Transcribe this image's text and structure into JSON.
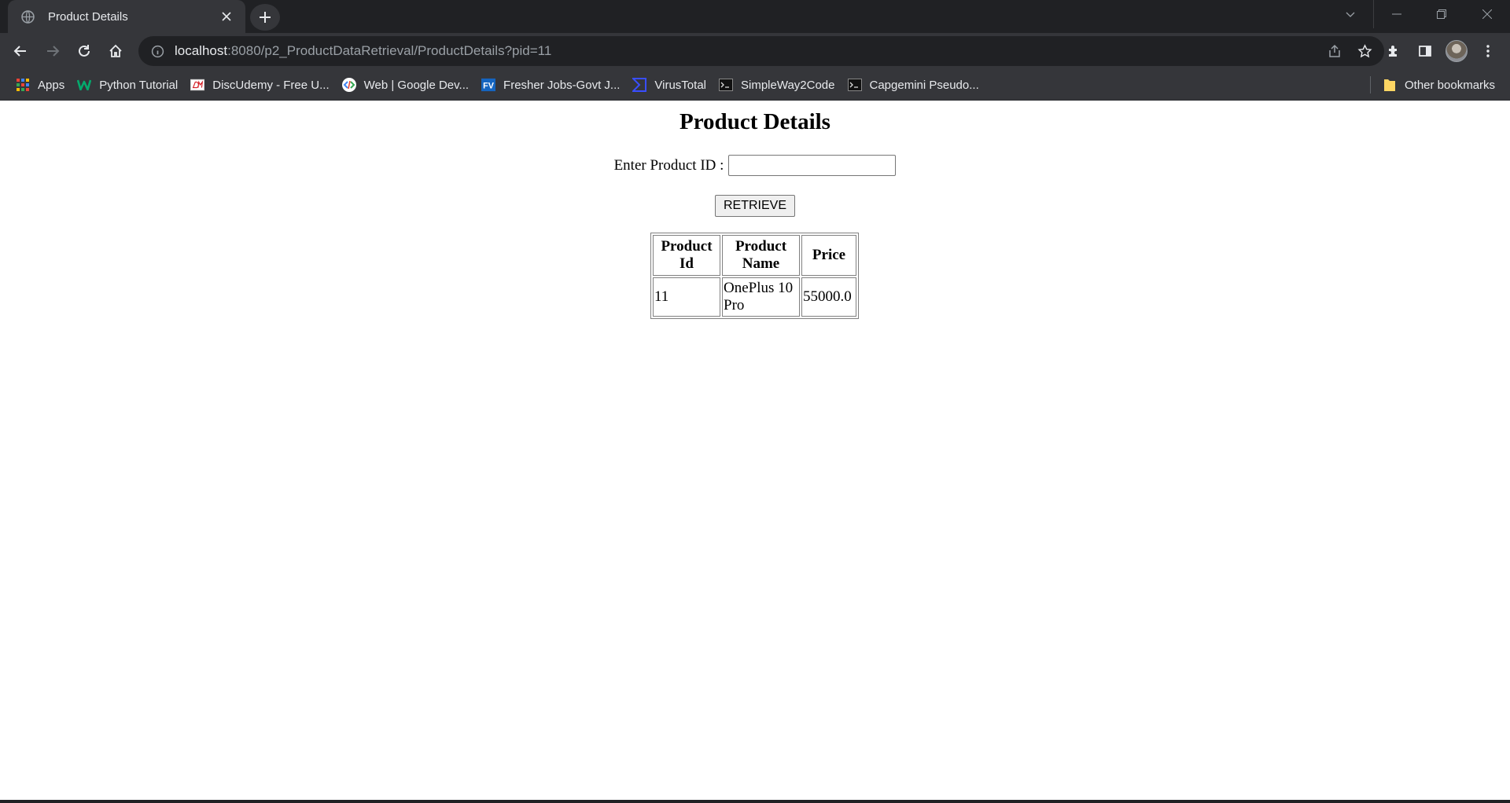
{
  "browser": {
    "tab": {
      "title": "Product Details"
    },
    "address": {
      "host": "localhost",
      "rest": ":8080/p2_ProductDataRetrieval/ProductDetails?pid=11"
    },
    "bookmarks": [
      {
        "label": "Apps",
        "icon": "apps-grid-icon"
      },
      {
        "label": "Python Tutorial",
        "icon": "w3schools-icon"
      },
      {
        "label": "DiscUdemy - Free U...",
        "icon": "discudemy-icon"
      },
      {
        "label": "Web  |  Google Dev...",
        "icon": "google-developers-icon"
      },
      {
        "label": "Fresher Jobs-Govt J...",
        "icon": "fv-icon"
      },
      {
        "label": "VirusTotal",
        "icon": "virustotal-icon"
      },
      {
        "label": "SimpleWay2Code",
        "icon": "terminal-icon"
      },
      {
        "label": "Capgemini Pseudo...",
        "icon": "terminal-icon"
      }
    ],
    "other_bookmarks": "Other bookmarks",
    "colors": {
      "chrome_dark": "#202124",
      "chrome_toolbar": "#35363a",
      "text": "#e8eaed"
    }
  },
  "page": {
    "title": "Product Details",
    "form": {
      "label": "Enter Product ID :",
      "value": "",
      "button": "RETRIEVE"
    },
    "table": {
      "headers": [
        [
          "Product",
          "Id"
        ],
        [
          "Product",
          "Name"
        ],
        [
          "Price"
        ]
      ],
      "rows": [
        {
          "id": "11",
          "name": [
            "OnePlus 10",
            "Pro"
          ],
          "price": "55000.0"
        }
      ]
    }
  }
}
